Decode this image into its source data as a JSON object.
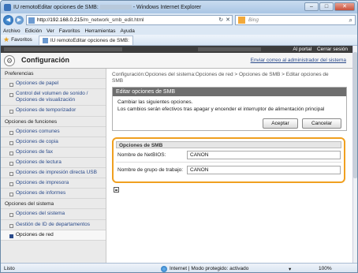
{
  "window": {
    "title_left": "IU remotoEditar opciones de SMB:",
    "title_right": "- Windows Internet Explorer",
    "btn_min": "–",
    "btn_max": "□",
    "btn_close": "✕"
  },
  "address": {
    "url_host": "http://192.168.0.215",
    "url_path": "/m_network_smb_edit.html",
    "ctl_refresh": "↻",
    "ctl_stop": "✕",
    "search_placeholder": "Bing",
    "search_icon": "⌕"
  },
  "menu": [
    "Archivo",
    "Edición",
    "Ver",
    "Favoritos",
    "Herramientas",
    "Ayuda"
  ],
  "favorites": {
    "label": "Favoritos",
    "tab_title": "IU remotoEditar opciones de SMB:"
  },
  "portal": {
    "portal_link": "Al portal",
    "logout_link": "Cerrar sesión"
  },
  "header": {
    "title": "Configuración",
    "mail_link": "Enviar correo al administrador del sistema"
  },
  "sidebar": {
    "sections": [
      {
        "title": "Preferencias",
        "items": [
          "Opciones de papel",
          "Control del volumen de sonido / Opciones de visualización",
          "Opciones de temporizador"
        ]
      },
      {
        "title": "Opciones de funciones",
        "items": [
          "Opciones comunes",
          "Opciones de copia",
          "Opciones de fax",
          "Opciones de lectura",
          "Opciones de impresión directa USB",
          "Opciones de impresora",
          "Opciones de informes"
        ]
      },
      {
        "title": "Opciones del sistema",
        "items": [
          "Opciones del sistema",
          "Gestión de ID de departamentos",
          "Opciones de red"
        ]
      }
    ]
  },
  "main": {
    "breadcrumb": "Configuración:Opciones del sistema:Opciones de red > Opciones de SMB > Editar opciones de SMB",
    "edit_title": "Editar opciones de SMB",
    "edit_line1": "Cambiar las siguientes opciones.",
    "edit_line2": "Los cambios serán efectivos tras apagar y encender el interruptor de alimentación principal",
    "accept_label": "Aceptar",
    "cancel_label": "Cancelar",
    "smb_title": "Opciones de SMB",
    "netbios_label": "Nombre de NetBIOS:",
    "netbios_value": "CANON",
    "workgroup_label": "Nombre de grupo de trabajo:",
    "workgroup_value": "CANON"
  },
  "status": {
    "left": "Listo",
    "zone": "Internet | Modo protegido: activado",
    "zoom_ctl": "▾",
    "zoom": "100%"
  },
  "colors": {
    "highlight": "#f0a020",
    "panel_header": "#6e6e6e",
    "link": "#2a4a8a"
  }
}
